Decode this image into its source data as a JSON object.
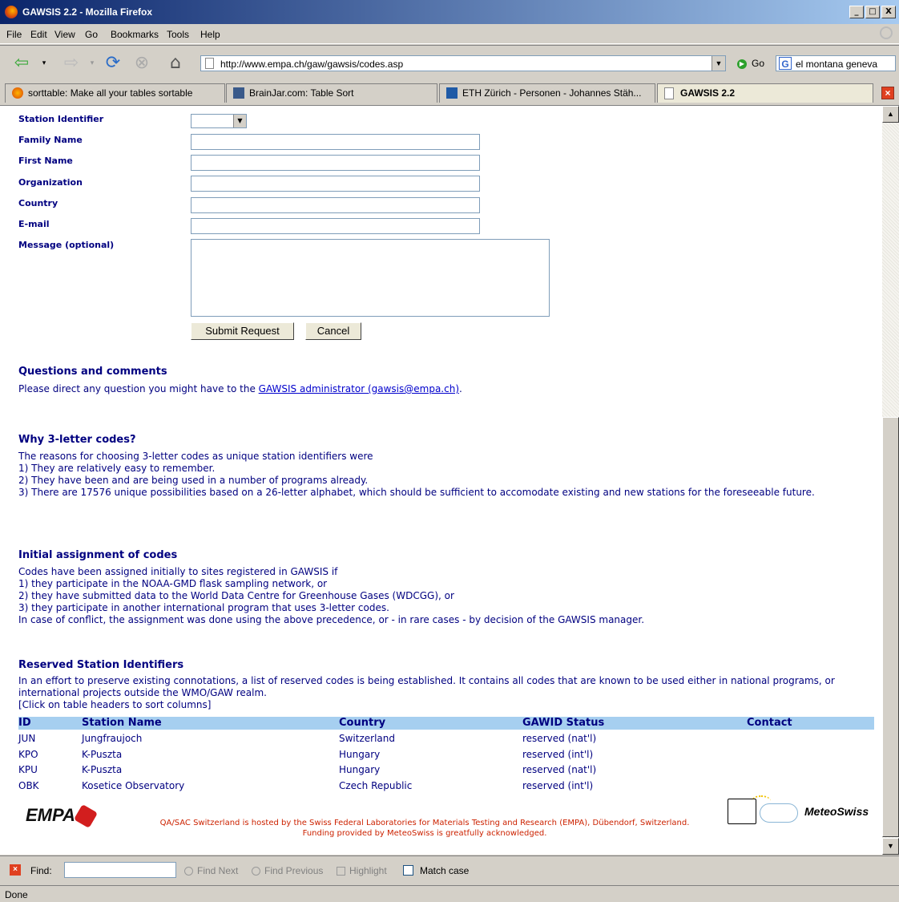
{
  "window": {
    "title": "GAWSIS 2.2 - Mozilla Firefox",
    "controls": [
      "_",
      "□",
      "X"
    ]
  },
  "menu": [
    "File",
    "Edit",
    "View",
    "Go",
    "Bookmarks",
    "Tools",
    "Help"
  ],
  "toolbar": {
    "url": "http://www.empa.ch/gaw/gawsis/codes.asp",
    "go_label": "Go",
    "search_value": "el montana geneva",
    "search_icon_letter": "G"
  },
  "tabs": [
    {
      "label": "sorttable: Make all your tables sortable",
      "active": false
    },
    {
      "label": "BrainJar.com: Table Sort",
      "active": false
    },
    {
      "label": "ETH Zürich - Personen - Johannes Stäh...",
      "active": false
    },
    {
      "label": "GAWSIS 2.2",
      "active": true
    }
  ],
  "form": {
    "station_identifier_label": "Station Identifier",
    "family_name_label": "Family Name",
    "first_name_label": "First Name",
    "organization_label": "Organization",
    "country_label": "Country",
    "email_label": "E-mail",
    "message_label": "Message (optional)",
    "submit_label": "Submit Request",
    "cancel_label": "Cancel"
  },
  "questions": {
    "heading": "Questions and comments",
    "text": "Please direct any question you might have to the ",
    "link": "GAWSIS administrator (gawsis@empa.ch)",
    "after_link": "."
  },
  "why": {
    "heading": "Why 3-letter codes?",
    "lines": [
      "The reasons for choosing 3-letter codes as unique station identifiers were",
      "1) They are relatively easy to remember.",
      "2) They have been and are being used in a number of programs already.",
      "3) There are 17576 unique possibilities based on a 26-letter alphabet, which should be sufficient to accomodate existing and new stations for the foreseeable future."
    ]
  },
  "initial": {
    "heading": "Initial assignment of codes",
    "lines": [
      "Codes have been assigned initially to sites registered in GAWSIS if",
      "1) they participate in the NOAA-GMD flask sampling network, or",
      "2) they have submitted data to the World Data Centre for Greenhouse Gases (WDCGG), or",
      "3) they participate in another international program that uses 3-letter codes.",
      "In case of conflict, the assignment was done using the above precedence, or - in rare cases - by decision of the GAWSIS manager."
    ]
  },
  "reserved": {
    "heading": "Reserved Station Identifiers",
    "intro": "In an effort to preserve existing connotations, a list of reserved codes is being established. It contains all codes that are known to be used either in national programs, or international projects outside the WMO/GAW realm.",
    "hint": "[Click on table headers to sort columns]",
    "columns": [
      "ID",
      "Station Name",
      "Country",
      "GAWID Status",
      "Contact"
    ],
    "rows": [
      [
        "JUN",
        "Jungfraujoch",
        "Switzerland",
        "reserved (nat'l)",
        ""
      ],
      [
        "KPO",
        "K-Puszta",
        "Hungary",
        "reserved (int'l)",
        ""
      ],
      [
        "KPU",
        "K-Puszta",
        "Hungary",
        "reserved (nat'l)",
        ""
      ],
      [
        "OBK",
        "Kosetice Observatory",
        "Czech Republic",
        "reserved (int'l)",
        ""
      ]
    ]
  },
  "footer": {
    "empa_logo": "EMPA",
    "line1": "QA/SAC Switzerland is hosted by the Swiss Federal Laboratories for Materials Testing and Research (EMPA), Dübendorf, Switzerland.",
    "line2": "Funding provided by MeteoSwiss is greatfully acknowledged.",
    "meteo_logo": "MeteoSwiss"
  },
  "findbar": {
    "label": "Find:",
    "find_next": "Find Next",
    "find_previous": "Find Previous",
    "highlight": "Highlight",
    "match_case": "Match case"
  },
  "status": "Done",
  "colors": {
    "content_text": "#000080",
    "table_header_bg": "#a6cff0",
    "footer_text": "#cc2200"
  }
}
